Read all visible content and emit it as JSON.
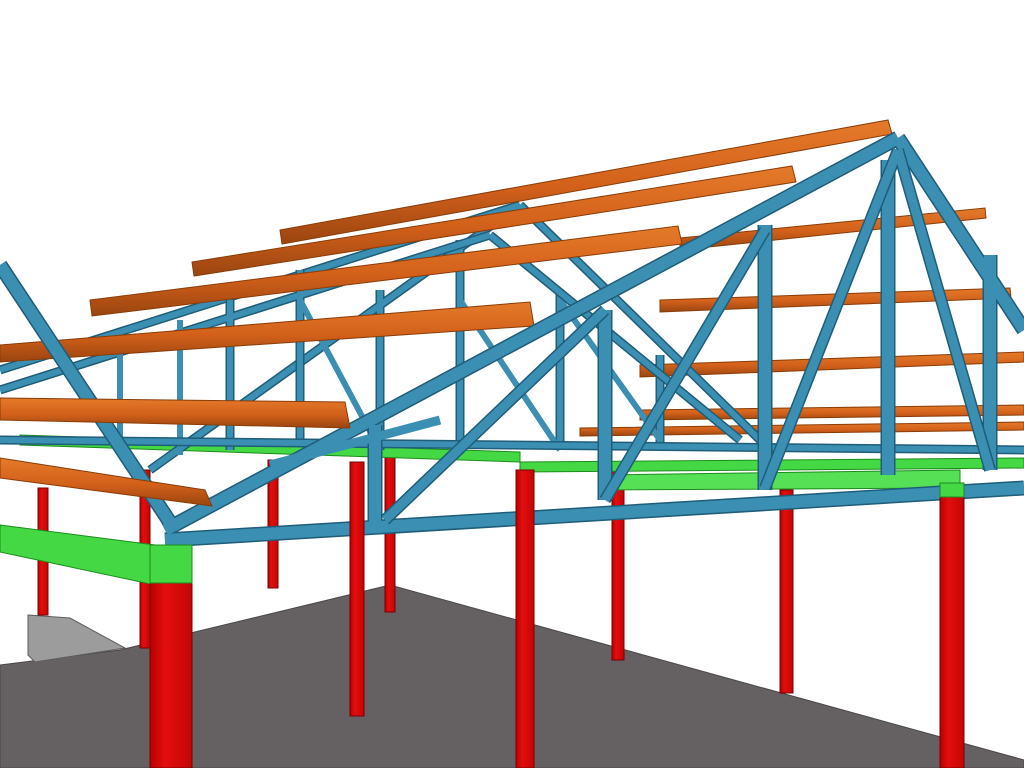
{
  "model": {
    "view": "3D perspective",
    "background_color": "#ffffff",
    "members": {
      "truss": {
        "color": "#3a8fb3",
        "edge": "#1f5d78"
      },
      "purlin": {
        "color": "#d9661a",
        "edge": "#8a3c08"
      },
      "column": {
        "color": "#dd0b0b",
        "edge": "#7a0000"
      },
      "beam": {
        "color": "#44d944",
        "edge": "#1d8c1d"
      },
      "slab": {
        "color": "#656162",
        "edge": "#4a4748"
      },
      "wall": {
        "color": "#999999",
        "edge": "#5d5d5d"
      }
    },
    "counts": {
      "trusses": 4,
      "purlins": 13,
      "columns": 10
    }
  }
}
